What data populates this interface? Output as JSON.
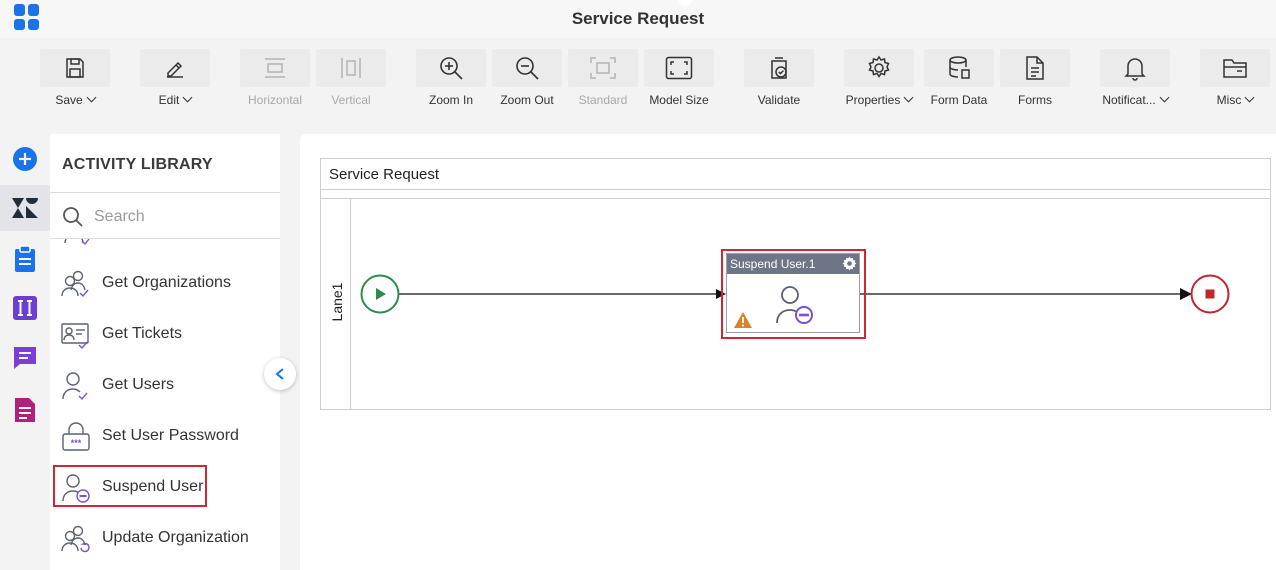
{
  "window": {
    "title": "Service Request"
  },
  "toolbar": {
    "save": "Save",
    "edit": "Edit",
    "horizontal": "Horizontal",
    "vertical": "Vertical",
    "zoom_in": "Zoom In",
    "zoom_out": "Zoom Out",
    "standard": "Standard",
    "model_size": "Model Size",
    "validate": "Validate",
    "properties": "Properties",
    "form_data": "Form Data",
    "forms": "Forms",
    "notifications": "Notificat...",
    "misc": "Misc"
  },
  "library": {
    "heading": "ACTIVITY LIBRARY",
    "search_placeholder": "Search",
    "items": [
      {
        "label": "Get Organizations",
        "icon": "users-check-icon"
      },
      {
        "label": "Get Tickets",
        "icon": "ticket-check-icon"
      },
      {
        "label": "Get Users",
        "icon": "user-check-icon"
      },
      {
        "label": "Set User Password",
        "icon": "password-lock-icon"
      },
      {
        "label": "Suspend User",
        "icon": "user-suspend-icon"
      },
      {
        "label": "Update Organization",
        "icon": "users-refresh-icon"
      }
    ]
  },
  "canvas": {
    "pool_title": "Service Request",
    "lane_label": "Lane1",
    "task_title": "Suspend User.1"
  },
  "colors": {
    "accent": "#1a73e8",
    "highlight": "#d0282e",
    "start_event": "#2e8b4e",
    "end_event": "#c0272d",
    "purple": "#7b4fd6",
    "warning": "#d9822b"
  }
}
